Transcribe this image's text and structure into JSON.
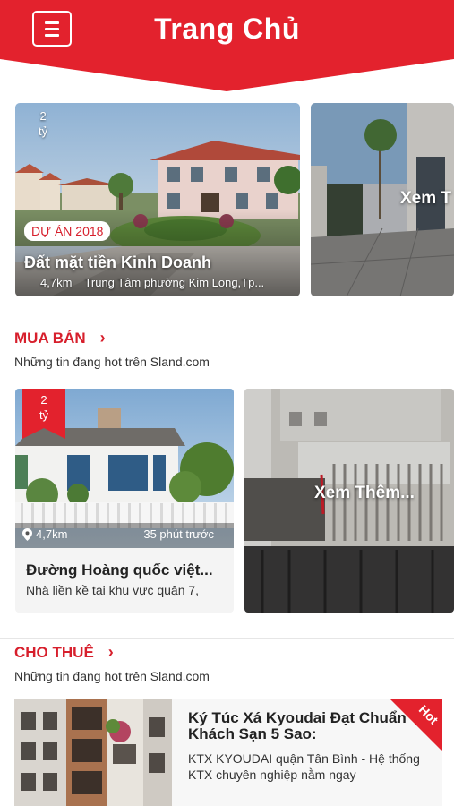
{
  "header": {
    "title": "Trang Chủ",
    "menu_icon": "hamburger-icon",
    "color": "#e3222d"
  },
  "featured": [
    {
      "price_value": "2",
      "price_unit": "tỷ",
      "tag": "DỰ ÁN 2018",
      "title": "Đất mặt tiền Kinh Doanh",
      "distance": "4,7km",
      "address": "Trung Tâm phường Kim Long,Tp..."
    },
    {
      "overlay": "Xem T"
    }
  ],
  "sale": {
    "title": "MUA BÁN",
    "subtitle": "Những tin đang hot trên Sland.com",
    "card": {
      "price_value": "2",
      "price_unit": "tỷ",
      "distance": "4,7km",
      "time": "35 phút trước",
      "title": "Đường Hoàng quốc việt...",
      "desc": "Nhà liền kề tại khu vực quận 7,"
    },
    "more": "Xem Thêm..."
  },
  "rent": {
    "title": "CHO THUÊ",
    "subtitle": "Những tin đang hot trên Sland.com",
    "card": {
      "title": "Ký Túc Xá Kyoudai Đạt Chuẩn Khách Sạn 5 Sao:",
      "desc": "KTX KYOUDAI quận Tân Bình - Hệ thống KTX chuyên nghiệp nằm ngay",
      "badge": "Hot"
    }
  },
  "colors": {
    "accent": "#d71f2c"
  }
}
